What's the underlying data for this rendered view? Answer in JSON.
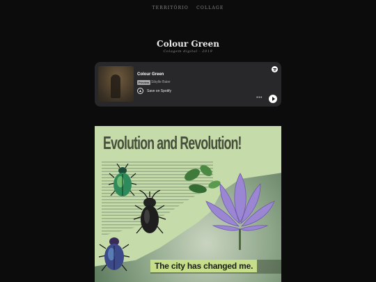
{
  "nav": {
    "items": [
      "TERRITÓRIO",
      "COLLAGE"
    ]
  },
  "page": {
    "title": "Colour Green",
    "subtitle": "Colagem digital · 2019"
  },
  "spotify_embed": {
    "track_title": "Colour Green",
    "badge": "Preview",
    "artist": "Sibylle Baier",
    "save_label": "Save on Spotify",
    "more_label": "•••",
    "logo_icon": "spotify-icon",
    "play_icon": "play-icon"
  },
  "collage": {
    "headline": "Evolution and Revolution!",
    "caption": "The city has changed me.",
    "colors": {
      "paper": "#c5dcaa",
      "headline": "#474e3c",
      "caption_bg": "#c6dd8c",
      "lotus": "#9b86d4"
    }
  }
}
